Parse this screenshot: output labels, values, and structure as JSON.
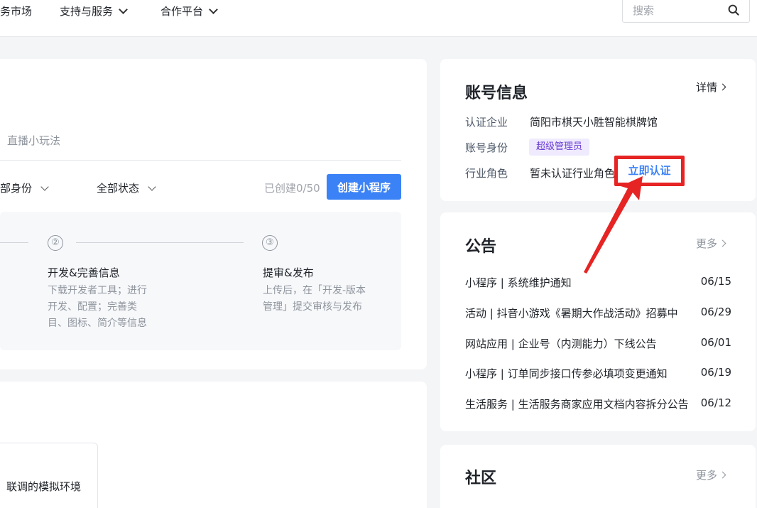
{
  "topnav": {
    "items": [
      {
        "label": "务市场",
        "has_chevron": false
      },
      {
        "label": "支持与服务",
        "has_chevron": true
      },
      {
        "label": "合作平台",
        "has_chevron": true
      }
    ],
    "search": {
      "placeholder": "搜索",
      "value": ""
    }
  },
  "main": {
    "tab_label": "直播小玩法",
    "filters": {
      "identity": "部身份",
      "status": "全部状态"
    },
    "created_count": "已创建0/50",
    "create_button": "创建小程序",
    "steps": [
      {
        "number": "②",
        "title": "开发&完善信息",
        "desc": [
          "下载开发者工具；进行",
          "开发、配置；完善类",
          "目、图标、简介等信息"
        ]
      },
      {
        "number": "③",
        "title": "提审&发布",
        "desc": [
          "上传后，在「开发-版本",
          "管理」提交审核与发布"
        ]
      }
    ],
    "env_text": "联调的模拟环境"
  },
  "account": {
    "title": "账号信息",
    "detail_link": "详情",
    "rows": [
      {
        "label": "认证企业",
        "value": "简阳市棋天小胜智能棋牌馆"
      },
      {
        "label": "账号身份",
        "value": "超级管理员"
      },
      {
        "label": "行业角色",
        "value": "暂未认证行业角色"
      }
    ],
    "verify_button": "立即认证"
  },
  "announcements": {
    "title": "公告",
    "more": "更多",
    "items": [
      {
        "text": "小程序 | 系统维护通知",
        "date": "06/15"
      },
      {
        "text": "活动 | 抖音小游戏《暑期大作战活动》招募中",
        "date": "06/29"
      },
      {
        "text": "网站应用 | 企业号（内测能力）下线公告",
        "date": "06/01"
      },
      {
        "text": "小程序 | 订单同步接口传参必填项变更通知",
        "date": "06/19"
      },
      {
        "text": "生活服务 | 生活服务商家应用文档内容拆分公告",
        "date": "06/12"
      }
    ]
  },
  "community": {
    "title": "社区",
    "more": "更多"
  },
  "colors": {
    "accent": "#3b82f6",
    "highlight": "#e62424",
    "tag_bg": "#efeafd",
    "tag_text": "#6b3fd6"
  }
}
